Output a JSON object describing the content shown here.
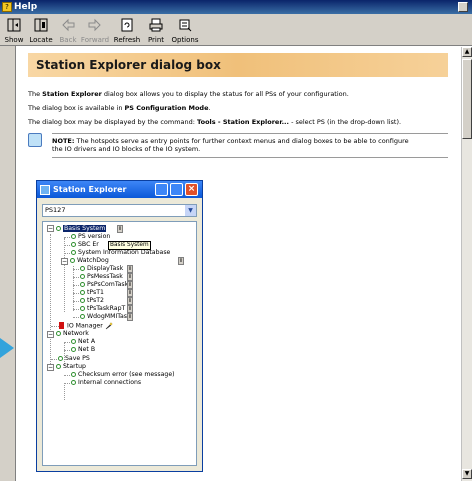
{
  "window": {
    "title": "Help"
  },
  "toolbar": {
    "buttons": [
      {
        "label": "Show",
        "icon": "show-icon",
        "enabled": true
      },
      {
        "label": "Locate",
        "icon": "locate-icon",
        "enabled": true
      },
      {
        "label": "Back",
        "icon": "back-arrow-icon",
        "enabled": false
      },
      {
        "label": "Forward",
        "icon": "forward-arrow-icon",
        "enabled": false
      },
      {
        "label": "Refresh",
        "icon": "refresh-icon",
        "enabled": true
      },
      {
        "label": "Print",
        "icon": "printer-icon",
        "enabled": true
      },
      {
        "label": "Options",
        "icon": "options-icon",
        "enabled": true
      }
    ]
  },
  "page": {
    "heading": "Station Explorer dialog box",
    "para1_a": "The ",
    "para1_b": "Station Explorer",
    "para1_c": " dialog box allows you to display the status for all PSs of your configuration.",
    "para2_a": "The dialog box is available in ",
    "para2_b": "PS Configuration Mode",
    "para2_c": ".",
    "para3_a": "The dialog box may be displayed by the command: ",
    "para3_b": "Tools - Station Explorer...",
    "para3_c": " - select PS (in the drop-down list).",
    "note_bold": "NOTE:",
    "note_line1": " The hotspots serve as entry points for further context menus and dialog boxes to be able to configure",
    "note_line2": "the IO drivers and IO blocks of the IO system."
  },
  "dialog": {
    "title": "Station Explorer",
    "combo_value": "PS127",
    "tooltip": "Basis System",
    "tree": {
      "basis_system": "Basis System",
      "ps_version": "PS version",
      "sbc_err_prefix": "SBC Er",
      "sbc_err_suffix": "ck",
      "sys_info_db": "System Information Database",
      "watchdog": "WatchDog",
      "display_task": "DisplayTask",
      "ps_mess_task": "PsMessTask",
      "ps_ps_com_task": "PsPsComTask",
      "tps_t1": "tPsT1",
      "tps_t2": "tPsT2",
      "tps_task_rap_t": "tPsTaskRapT",
      "wdog_mmi_task": "WdogMMITask",
      "io_manager": "IO Manager",
      "network": "Network",
      "net_a": "Net A",
      "net_b": "Net B",
      "save_ps": "Save PS",
      "startup": "Startup",
      "checksum_error": "Checksum error (see message)",
      "internal_connections": "Internal connections"
    }
  },
  "colors": {
    "accent_blue": "#0a246a",
    "banner": "#f0c07a",
    "xp_title": "#0a58d8",
    "arrow": "#33a3dc"
  }
}
